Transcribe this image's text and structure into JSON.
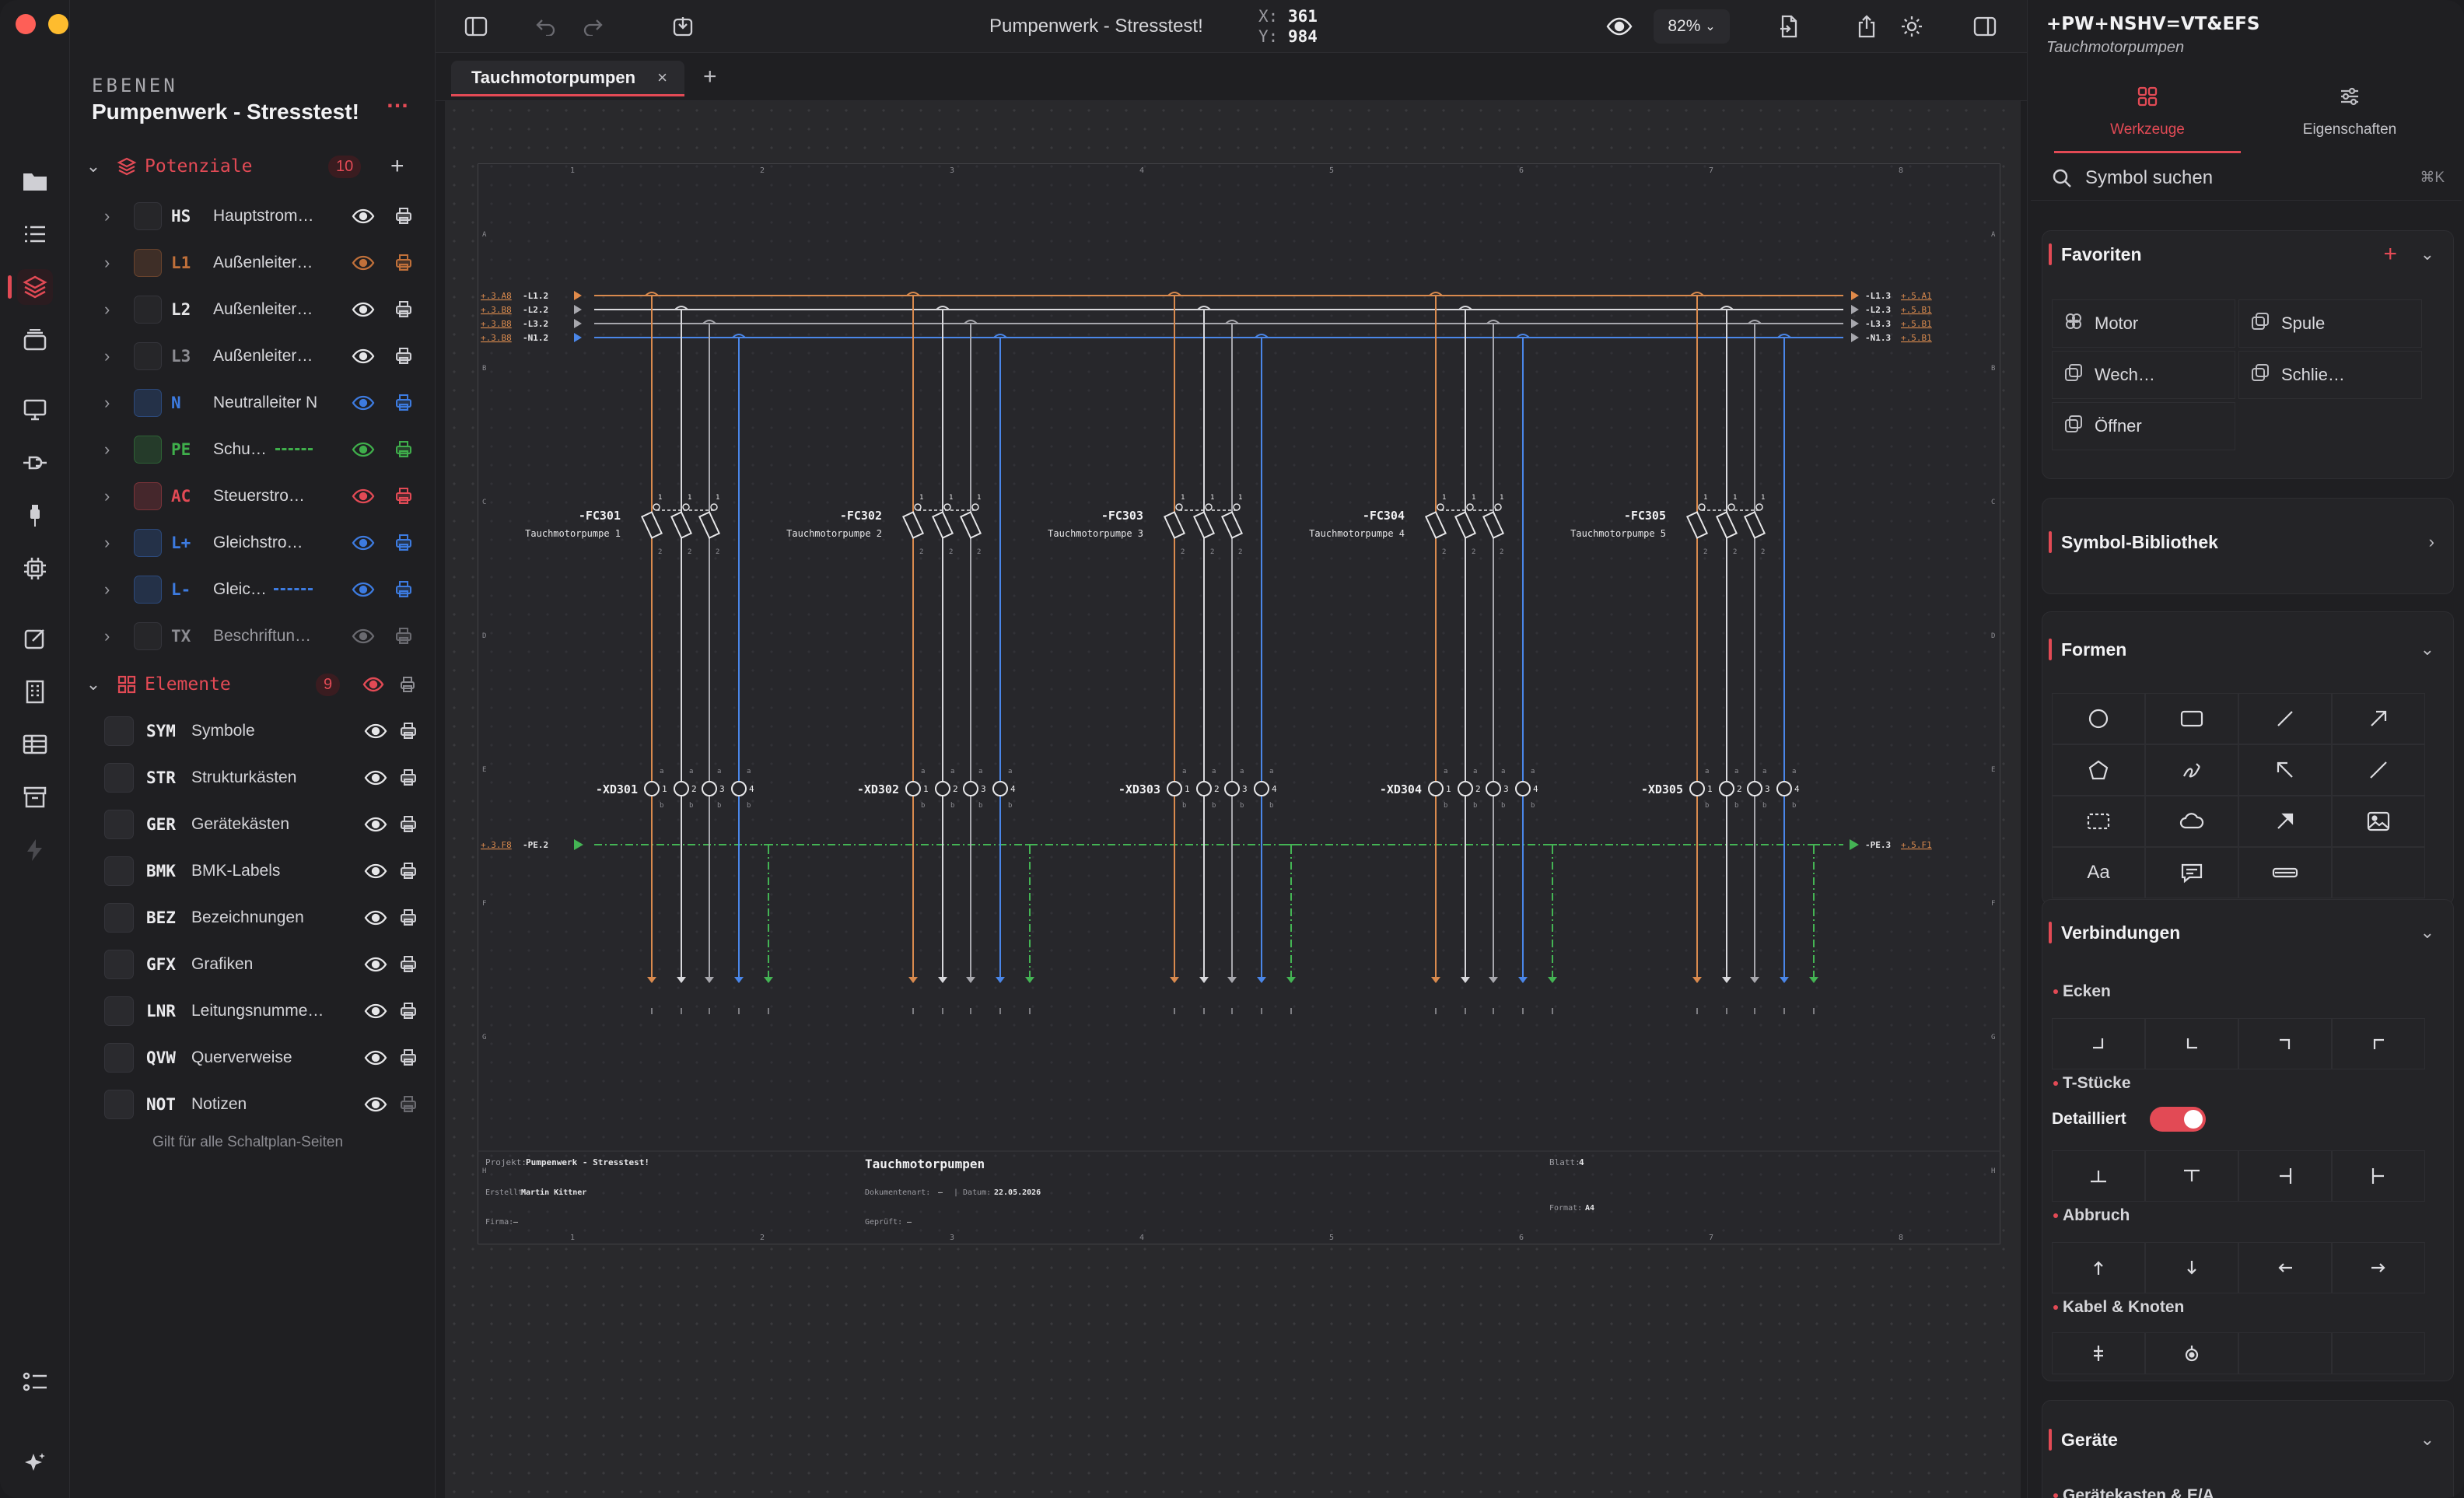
{
  "window": {
    "title": "Pumpenwerk - Stresstest!",
    "coords": {
      "x_label": "X:",
      "x": "361",
      "y_label": "Y:",
      "y": "984"
    },
    "zoom": "82%"
  },
  "layers": {
    "caption": "EBENEN",
    "project": "Pumpenwerk - Stresstest!",
    "more": "…",
    "potentials": {
      "title": "Potenziale",
      "count": "10",
      "items": [
        {
          "code": "HS",
          "label": "Hauptstrom…",
          "color": "#e6e6e8"
        },
        {
          "code": "L1",
          "label": "Außenleiter…",
          "color": "#c0703a"
        },
        {
          "code": "L2",
          "label": "Außenleiter…",
          "color": "#e6e6e8"
        },
        {
          "code": "L3",
          "label": "Außenleiter…",
          "color": "#8c8c92"
        },
        {
          "code": "N",
          "label": "Neutralleiter N",
          "color": "#3d7be0"
        },
        {
          "code": "PE",
          "label": "Schu…",
          "color": "#3fae4b"
        },
        {
          "code": "AC",
          "label": "Steuerstro…",
          "color": "#e24a55"
        },
        {
          "code": "L+",
          "label": "Gleichstro…",
          "color": "#3d7be0"
        },
        {
          "code": "L-",
          "label": "Gleic…",
          "color": "#3d7be0"
        },
        {
          "code": "TX",
          "label": "Beschriftun…",
          "color": "#8c8c92"
        }
      ]
    },
    "elements": {
      "title": "Elemente",
      "count": "9",
      "items": [
        {
          "code": "SYM",
          "label": "Symbole"
        },
        {
          "code": "STR",
          "label": "Strukturkästen"
        },
        {
          "code": "GER",
          "label": "Gerätekästen"
        },
        {
          "code": "BMK",
          "label": "BMK-Labels"
        },
        {
          "code": "BEZ",
          "label": "Bezeichnungen"
        },
        {
          "code": "GFX",
          "label": "Grafiken"
        },
        {
          "code": "LNR",
          "label": "Leitungsnumme…"
        },
        {
          "code": "QVW",
          "label": "Querverweise"
        },
        {
          "code": "NOT",
          "label": "Notizen"
        }
      ]
    },
    "footnote": "Gilt für alle Schaltplan-Seiten"
  },
  "tabs": {
    "active": "Tauchmotorpumpen",
    "close": "×",
    "add": "+"
  },
  "sheet": {
    "columns": [
      "1",
      "2",
      "3",
      "4",
      "5",
      "6",
      "7",
      "8"
    ],
    "rows": [
      "A",
      "B",
      "C",
      "D",
      "E",
      "F",
      "G",
      "H"
    ],
    "left_refs": [
      {
        "ref": "+.3.A8",
        "net": "-L1.2"
      },
      {
        "ref": "+.3.B8",
        "net": "-L2.2"
      },
      {
        "ref": "+.3.B8",
        "net": "-L3.2"
      },
      {
        "ref": "+.3.B8",
        "net": "-N1.2"
      }
    ],
    "right_refs": [
      {
        "net": "-L1.3",
        "ref": "+.5.A1"
      },
      {
        "net": "-L2.3",
        "ref": "+.5.B1"
      },
      {
        "net": "-L3.3",
        "ref": "+.5.B1"
      },
      {
        "net": "-N1.3",
        "ref": "+.5.B1"
      }
    ],
    "pe_left": {
      "ref": "+.3.F8",
      "net": "-PE.2"
    },
    "pe_right": {
      "net": "-PE.3",
      "ref": "+.5.F1"
    },
    "breakers": [
      {
        "tag": "-FC301",
        "desc": "Tauchmotorpumpe 1"
      },
      {
        "tag": "-FC302",
        "desc": "Tauchmotorpumpe 2"
      },
      {
        "tag": "-FC303",
        "desc": "Tauchmotorpumpe 3"
      },
      {
        "tag": "-FC304",
        "desc": "Tauchmotorpumpe 4"
      },
      {
        "tag": "-FC305",
        "desc": "Tauchmotorpumpe 5"
      }
    ],
    "terminals": [
      "-XD301",
      "-XD302",
      "-XD303",
      "-XD304",
      "-XD305"
    ],
    "pin_nums": [
      "1",
      "2",
      "3",
      "4"
    ],
    "pin_a": "a",
    "pin_b": "b",
    "title_block": {
      "project_label": "Projekt:",
      "project": "Pumpenwerk - Stresstest!",
      "created_label": "Erstellt:",
      "created": "Martin Kittner",
      "company_label": "Firma:",
      "company": "–",
      "title": "Tauchmotorpumpen",
      "doctype_label": "Dokumentenart:",
      "doctype": "–",
      "date_label": "| Datum:",
      "date": "22.05.2026",
      "checked_label": "Geprüft:",
      "checked": "–",
      "sheet_label": "Blatt:",
      "sheet": "4",
      "format_label": "Format:",
      "format": "A4"
    }
  },
  "right_panel": {
    "path": "+PW+NSHV=VT&EFS",
    "subtitle": "Tauchmotorpumpen",
    "tab_tools": "Werkzeuge",
    "tab_props": "Eigenschaften",
    "search_placeholder": "Symbol suchen",
    "search_shortcut": "⌘K",
    "favorites": {
      "title": "Favoriten",
      "items": [
        "Motor",
        "Spule",
        "Wech…",
        "Schlie…",
        "Öffner"
      ]
    },
    "library": {
      "title": "Symbol-Bibliothek"
    },
    "shapes": {
      "title": "Formen",
      "text_tool": "Aa"
    },
    "connections": {
      "title": "Verbindungen",
      "corners": "Ecken",
      "tees": "T-Stücke",
      "detailed": "Detailliert",
      "breaks": "Abbruch",
      "cable": "Kabel & Knoten"
    },
    "devices": {
      "title": "Geräte",
      "sub": "Gerätekasten & E/A"
    }
  },
  "colors": {
    "accent": "#e24a55",
    "L1": "#d98a4e",
    "L2": "#d8d8dc",
    "L3": "#a7a7ad",
    "N": "#4a86e8",
    "PE": "#44b454"
  }
}
